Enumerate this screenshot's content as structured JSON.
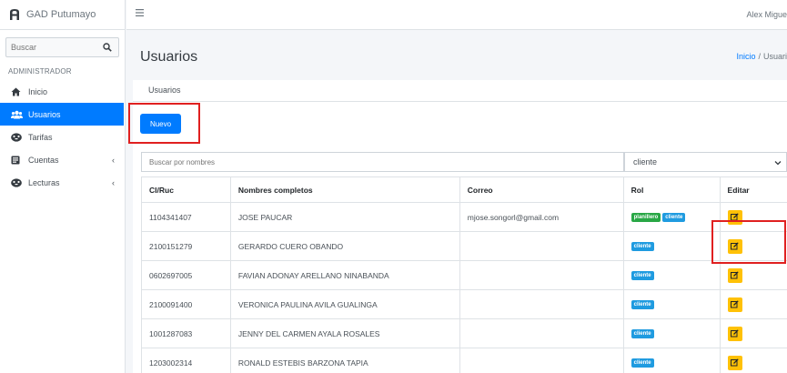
{
  "brand": {
    "name": "GAD Putumayo",
    "logo_icon": "brand-logo-icon"
  },
  "sidebar": {
    "search_placeholder": "Buscar",
    "section_header": "ADMINISTRADOR",
    "items": [
      {
        "label": "Inicio",
        "icon": "home-icon",
        "active": false,
        "has_chevron": false
      },
      {
        "label": "Usuarios",
        "icon": "users-icon",
        "active": true,
        "has_chevron": false
      },
      {
        "label": "Tarifas",
        "icon": "tarifas-icon",
        "active": false,
        "has_chevron": false
      },
      {
        "label": "Cuentas",
        "icon": "cuentas-icon",
        "active": false,
        "has_chevron": true
      },
      {
        "label": "Lecturas",
        "icon": "lecturas-icon",
        "active": false,
        "has_chevron": true
      }
    ],
    "chevron": "‹"
  },
  "topbar": {
    "user_name": "Alex Migue"
  },
  "page": {
    "title": "Usuarios",
    "breadcrumb": {
      "home": "Inicio",
      "separator": "/",
      "current": "Usuari"
    }
  },
  "card": {
    "header": "Usuarios",
    "new_button": "Nuevo",
    "filter_placeholder": "Buscar por nombres",
    "role_select_value": "cliente"
  },
  "table": {
    "headers": [
      "CI/Ruc",
      "Nombres completos",
      "Correo",
      "Rol",
      "Editar"
    ],
    "rows": [
      {
        "ci": "1104341407",
        "name": "JOSE PAUCAR",
        "email": "mjose.songorl@gmail.com",
        "roles": [
          "planillero",
          "cliente"
        ]
      },
      {
        "ci": "2100151279",
        "name": "GERARDO CUERO OBANDO",
        "email": "",
        "roles": [
          "cliente"
        ]
      },
      {
        "ci": "0602697005",
        "name": "FAVIAN ADONAY ARELLANO NINABANDA",
        "email": "",
        "roles": [
          "cliente"
        ]
      },
      {
        "ci": "2100091400",
        "name": "VERONICA PAULINA AVILA GUALINGA",
        "email": "",
        "roles": [
          "cliente"
        ]
      },
      {
        "ci": "1001287083",
        "name": "JENNY DEL CARMEN AYALA ROSALES",
        "email": "",
        "roles": [
          "cliente"
        ]
      },
      {
        "ci": "1203002314",
        "name": "RONALD ESTEBIS BARZONA TAPIA",
        "email": "",
        "roles": [
          "cliente"
        ]
      }
    ]
  },
  "colors": {
    "primary": "#007bff",
    "badge_planillero": "#28a745",
    "badge_cliente": "#1f9be0",
    "edit_button": "#ffc107",
    "highlight": "#e02020"
  }
}
